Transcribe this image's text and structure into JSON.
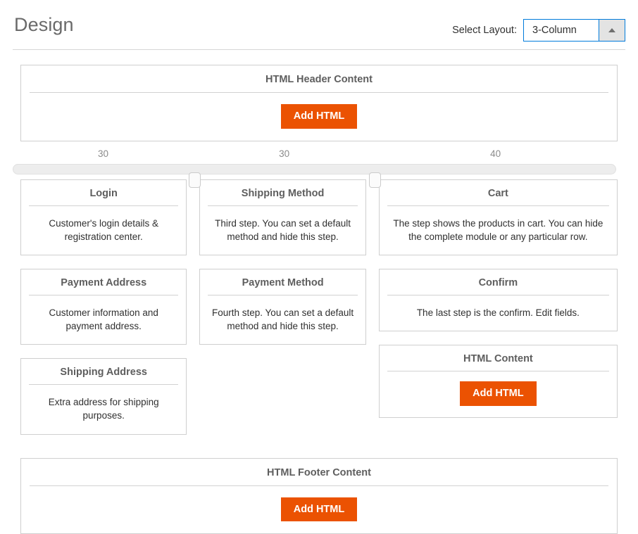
{
  "header": {
    "title": "Design",
    "select_label": "Select Layout:",
    "select_value": "3-Column",
    "caret_icon": "caret-up-icon"
  },
  "html_header_block": {
    "title": "HTML Header Content",
    "button_label": "Add HTML"
  },
  "slider": {
    "handles": [
      {
        "position_pct": 30
      },
      {
        "position_pct": 60
      }
    ],
    "labels": [
      {
        "value": "30",
        "center_pct": 15
      },
      {
        "value": "30",
        "center_pct": 45
      },
      {
        "value": "40",
        "center_pct": 80
      }
    ]
  },
  "columns": [
    {
      "width_pct": 30,
      "cards": [
        {
          "title": "Login",
          "description": "Customer's login details & registration center."
        },
        {
          "title": "Payment Address",
          "description": "Customer information and payment address."
        },
        {
          "title": "Shipping Address",
          "description": "Extra address for shipping purposes."
        }
      ]
    },
    {
      "width_pct": 30,
      "cards": [
        {
          "title": "Shipping Method",
          "description": "Third step. You can set a default method and hide this step."
        },
        {
          "title": "Payment Method",
          "description": "Fourth step. You can set a default method and hide this step."
        }
      ]
    },
    {
      "width_pct": 40,
      "cards": [
        {
          "title": "Cart",
          "description": "The step shows the products in cart. You can hide the complete module or any particular row."
        },
        {
          "title": "Confirm",
          "description": "The last step is the confirm. Edit fields."
        },
        {
          "title": "HTML Content",
          "button_label": "Add HTML"
        }
      ]
    }
  ],
  "html_footer_block": {
    "title": "HTML Footer Content",
    "button_label": "Add HTML"
  },
  "colors": {
    "accent_orange": "#eb5202",
    "select_border_blue": "#007bdb",
    "title_gray": "#6a6a6a",
    "card_border": "#cfcfcf"
  }
}
